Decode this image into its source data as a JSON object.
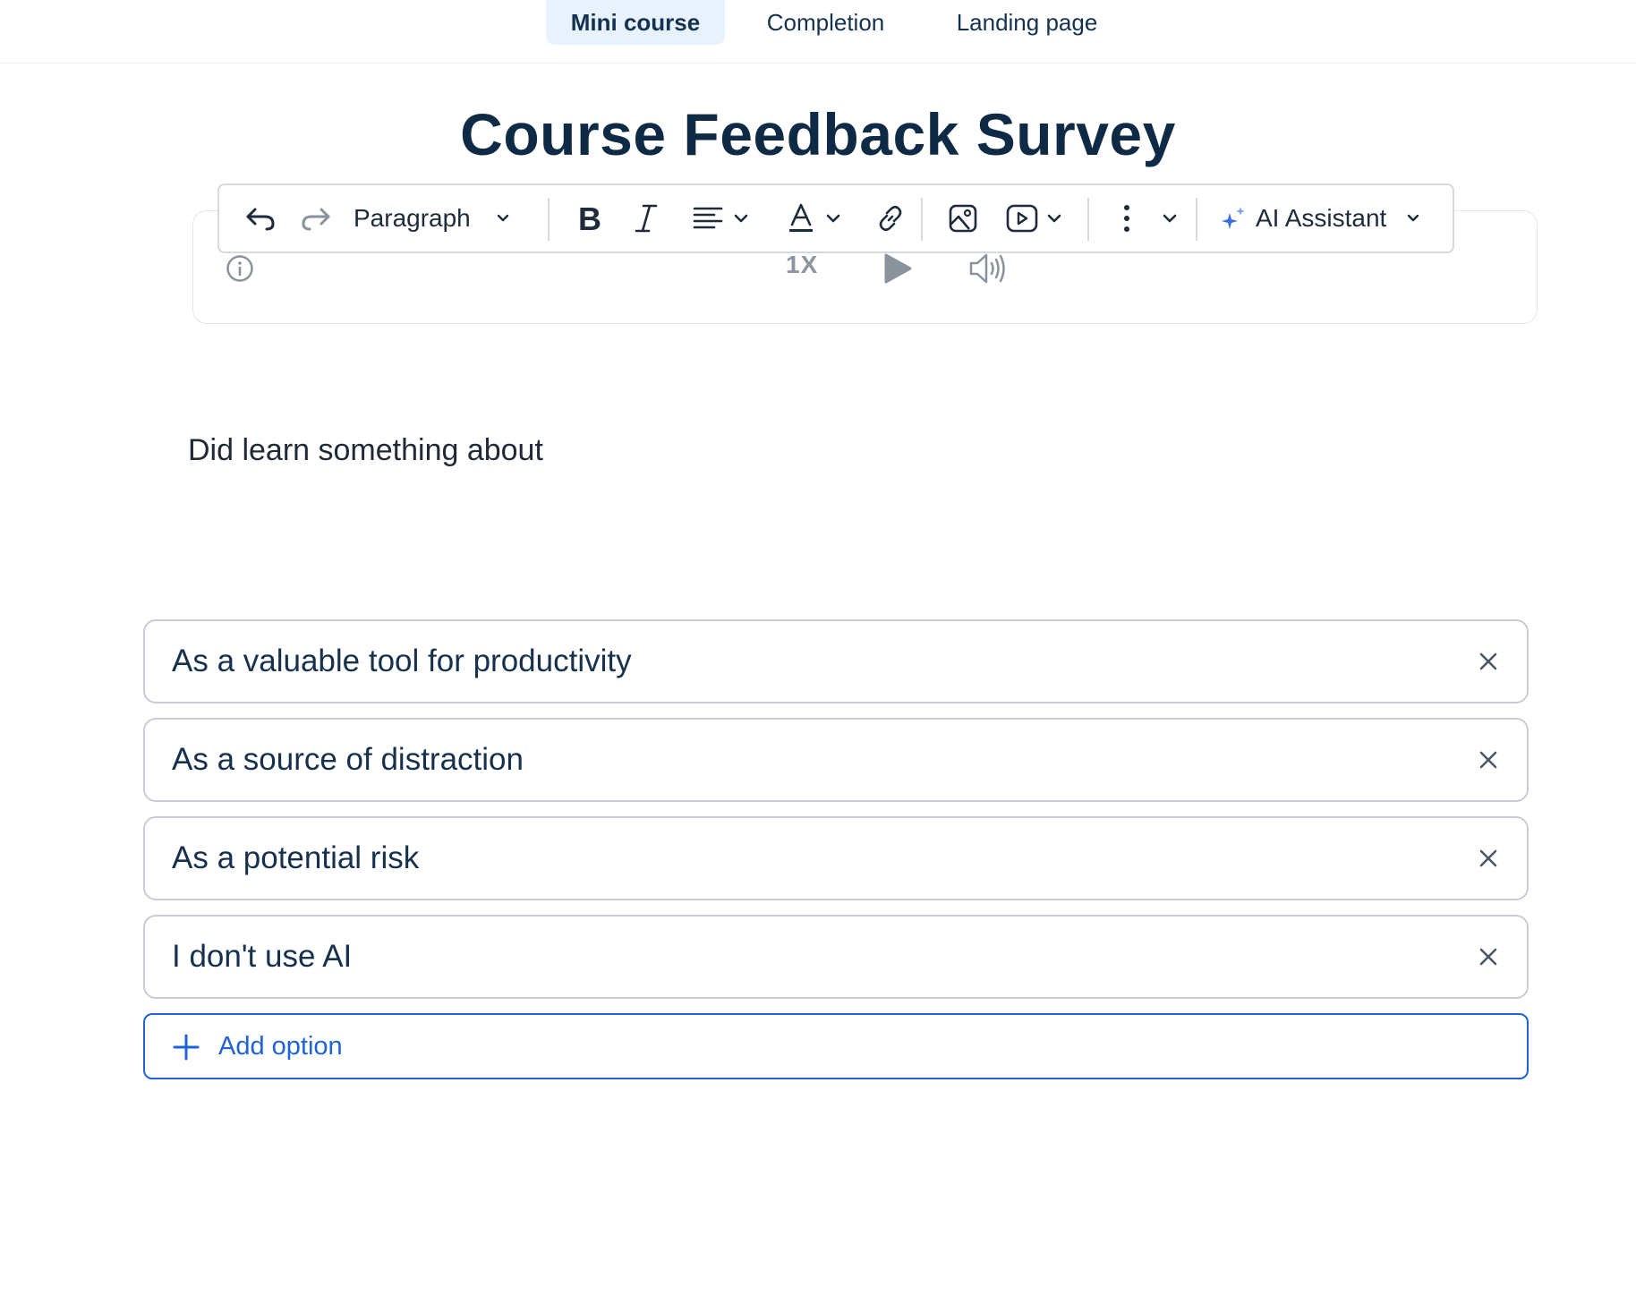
{
  "tabs": [
    {
      "label": "Mini course",
      "active": true
    },
    {
      "label": "Completion",
      "active": false
    },
    {
      "label": "Landing page",
      "active": false
    }
  ],
  "page_title": "Course Feedback Survey",
  "toolbar": {
    "block_type": "Paragraph",
    "ai_assistant_label": "AI Assistant",
    "icons": [
      "undo-icon",
      "redo-icon",
      "chevron-down-icon",
      "bold-icon",
      "italic-icon",
      "align-left-icon",
      "text-color-icon",
      "link-icon",
      "image-icon",
      "video-icon",
      "more-vertical-icon",
      "sparkle-icon"
    ]
  },
  "audio": {
    "speed": "1X",
    "icons": [
      "info-icon",
      "play-icon",
      "volume-icon"
    ]
  },
  "question": "Did learn something about",
  "options": [
    {
      "text": "As a valuable tool for productivity"
    },
    {
      "text": "As a source of distraction"
    },
    {
      "text": "As a potential risk"
    },
    {
      "text": "I don't use AI"
    }
  ],
  "add_option_label": "Add option",
  "colors": {
    "accent_blue": "#1f63d6",
    "active_tab_bg": "#e8f2fd",
    "title_text": "#0f2a44",
    "border": "#c9cdd3"
  }
}
